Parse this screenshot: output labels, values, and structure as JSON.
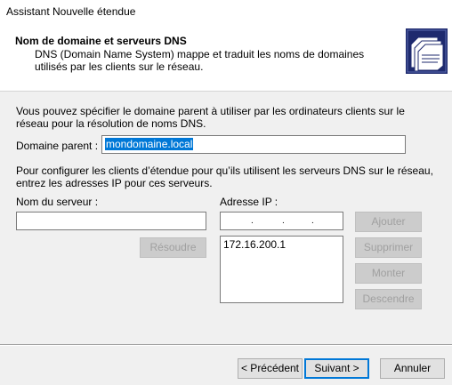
{
  "window": {
    "title": "Assistant Nouvelle étendue"
  },
  "header": {
    "title": "Nom de domaine et serveurs DNS",
    "description": "DNS (Domain Name System) mappe et traduit les noms de domaines utilisés par les clients sur le réseau."
  },
  "main": {
    "intro_text": "Vous pouvez spécifier le domaine parent à utiliser par les ordinateurs clients sur le réseau pour la résolution de noms DNS.",
    "parent_domain_label": "Domaine parent :",
    "parent_domain_value": "mondomaine.local",
    "config_text": "Pour configurer les clients d’étendue pour qu’ils utilisent les serveurs DNS sur le réseau, entrez les adresses IP pour ces serveurs.",
    "server_name_label": "Nom du serveur :",
    "server_name_value": "",
    "ip_label": "Adresse IP :",
    "ip_value": "",
    "ip_list": [
      "172.16.200.1"
    ],
    "buttons": {
      "resolve": "Résoudre",
      "add": "Ajouter",
      "remove": "Supprimer",
      "up": "Monter",
      "down": "Descendre"
    }
  },
  "footer": {
    "back": "< Précédent",
    "next": "Suivant >",
    "cancel": "Annuler"
  },
  "colors": {
    "selection": "#0078d7",
    "icon_bg": "#1e2a6e"
  }
}
